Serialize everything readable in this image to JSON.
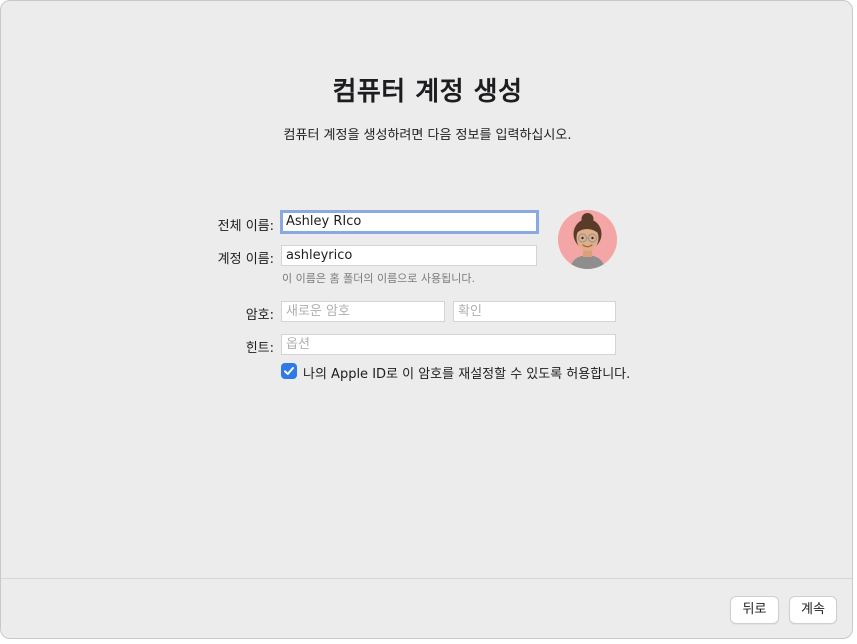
{
  "header": {
    "title": "컴퓨터 계정 생성",
    "subtitle": "컴퓨터 계정을 생성하려면 다음 정보를 입력하십시오."
  },
  "form": {
    "full_name_label": "전체 이름:",
    "full_name_value": "Ashley RIco",
    "account_name_label": "계정 이름:",
    "account_name_value": "ashleyrico",
    "account_name_note": "이 이름은 홈 폴더의 이름으로 사용됩니다.",
    "password_label": "암호:",
    "password_placeholder": "새로운 암호",
    "verify_placeholder": "확인",
    "hint_label": "힌트:",
    "hint_placeholder": "옵션",
    "reset_checkbox_label": "나의 Apple ID로 이 암호를 재설정할 수 있도록 허용합니다.",
    "reset_checkbox_checked": true
  },
  "avatar": {
    "icon": "memoji-avatar",
    "background_color": "#f4a6a6"
  },
  "footer": {
    "back_label": "뒤로",
    "continue_label": "계속"
  },
  "colors": {
    "accent": "#2f7ae5",
    "focus_ring": "#8aa9e0"
  }
}
